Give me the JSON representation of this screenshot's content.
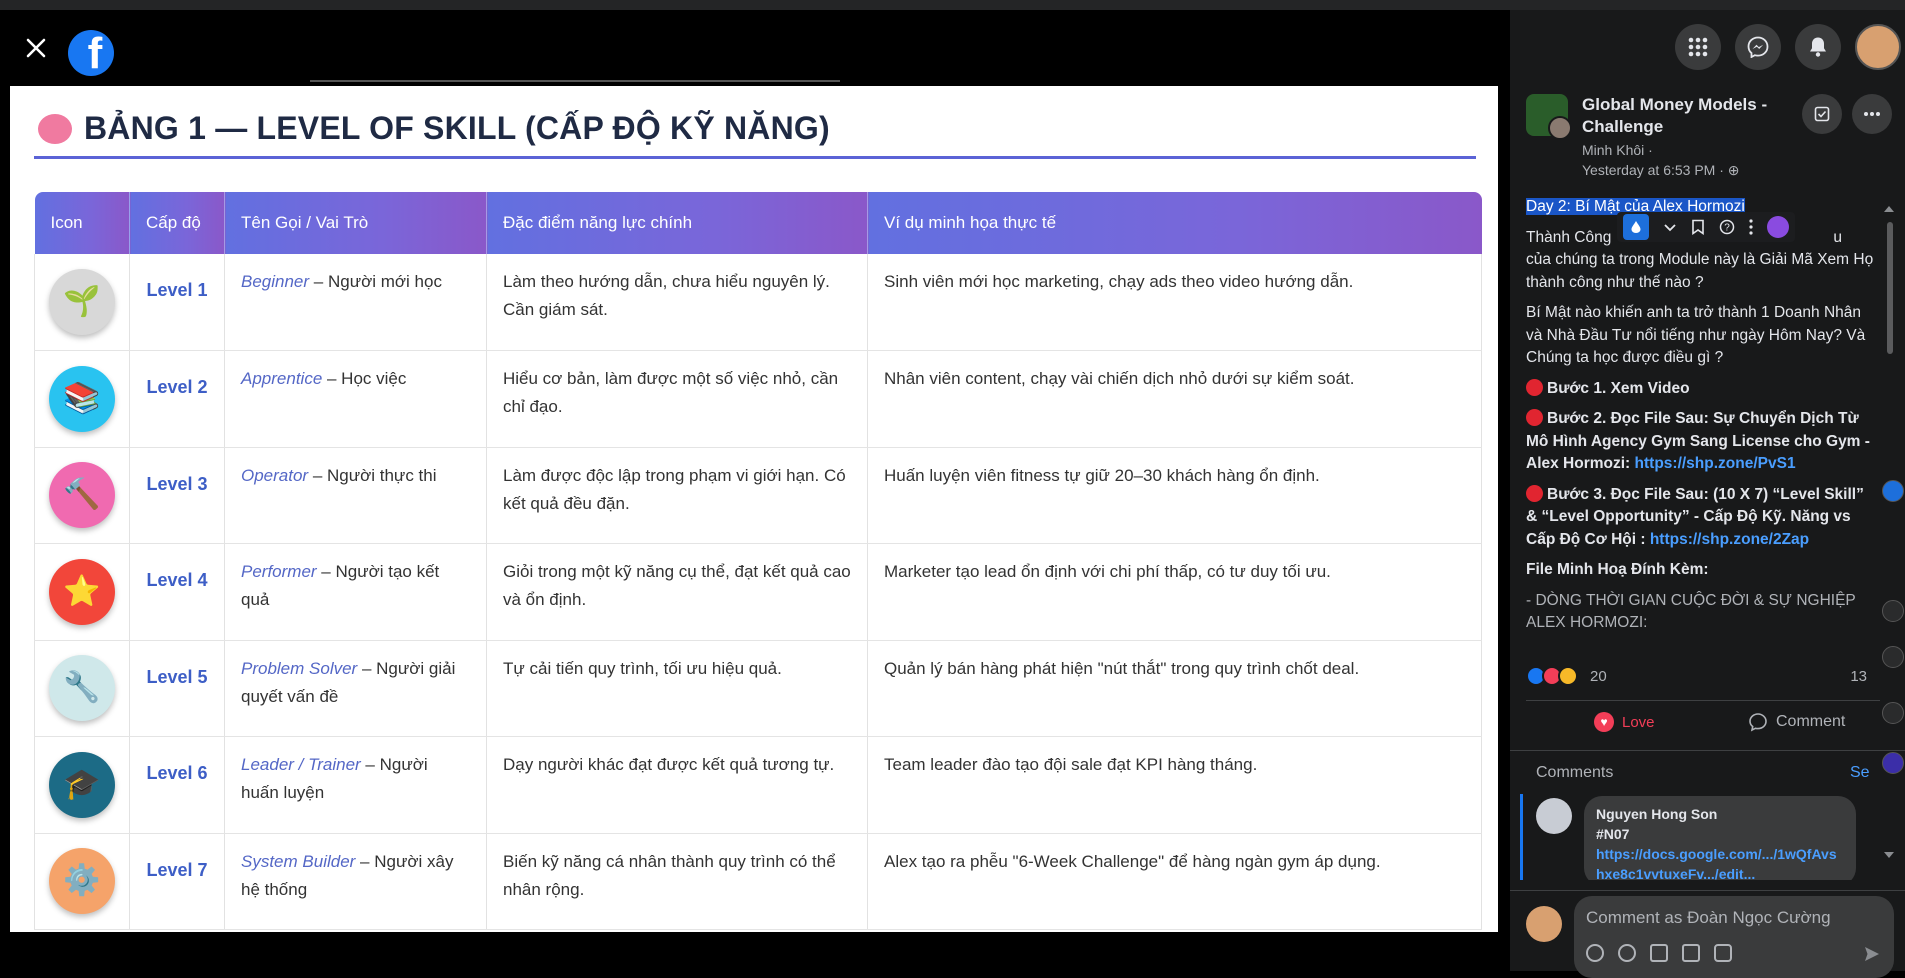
{
  "viewer": {
    "logo_letter": "f"
  },
  "image": {
    "title": "BẢNG 1 — LEVEL OF SKILL (CẤP ĐỘ KỸ NĂNG)",
    "columns": [
      "Icon",
      "Cấp độ",
      "Tên Gọi / Vai Trò",
      "Đặc điểm năng lực chính",
      "Ví dụ minh họa thực tế"
    ],
    "rows": [
      {
        "icon": "seedling-icon",
        "emoji": "🌱",
        "color": "#d8d8d8",
        "level": "Level 1",
        "role": "Beginner",
        "role_desc": " – Người mới học",
        "trait": "Làm theo hướng dẫn, chưa hiểu nguyên lý. Cần giám sát.",
        "example": "Sinh viên mới học marketing, chạy ads theo video hướng dẫn."
      },
      {
        "icon": "books-icon",
        "emoji": "📚",
        "color": "#29c3f0",
        "level": "Level 2",
        "role": "Apprentice",
        "role_desc": " – Học việc",
        "trait": "Hiểu cơ bản, làm được một số việc nhỏ, cần chỉ đạo.",
        "example": "Nhân viên content, chạy vài chiến dịch nhỏ dưới sự kiểm soát."
      },
      {
        "icon": "hammer-icon",
        "emoji": "🔨",
        "color": "#f06ab0",
        "level": "Level 3",
        "role": "Operator",
        "role_desc": " – Người thực thi",
        "trait": "Làm được độc lập trong phạm vi giới hạn. Có kết quả đều đặn.",
        "example": "Huấn luyện viên fitness tự giữ 20–30 khách hàng ổn định."
      },
      {
        "icon": "star-icon",
        "emoji": "⭐",
        "color": "#f2463a",
        "level": "Level 4",
        "role": "Performer",
        "role_desc": " – Người tạo kết quả",
        "trait": "Giỏi trong một kỹ năng cụ thể, đạt kết quả cao và ổn định.",
        "example": "Marketer tạo lead ổn định với chi phí thấp, có tư duy tối ưu."
      },
      {
        "icon": "wrench-icon",
        "emoji": "🔧",
        "color": "#cfe8ea",
        "level": "Level 5",
        "role": "Problem Solver",
        "role_desc": " – Người giải quyết vấn đề",
        "trait": "Tự cải tiến quy trình, tối ưu hiệu quả.",
        "example": "Quản lý bán hàng phát hiện \"nút thắt\" trong quy trình chốt deal."
      },
      {
        "icon": "graduation-cap-icon",
        "emoji": "🎓",
        "color": "#1c6b86",
        "level": "Level 6",
        "role": "Leader / Trainer",
        "role_desc": " – Người huấn luyện",
        "trait": "Dạy người khác đạt được kết quả tương tự.",
        "example": "Team leader đào tạo đội sale đạt KPI hàng tháng."
      },
      {
        "icon": "gear-icon",
        "emoji": "⚙️",
        "color": "#f5a36a",
        "level": "Level 7",
        "role": "System Builder",
        "role_desc": " – Người xây hệ thống",
        "trait": "Biến kỹ năng cá nhân thành quy trình có thể nhân rộng.",
        "example": "Alex tạo ra phễu \"6-Week Challenge\" để hàng ngàn gym áp dụng."
      }
    ]
  },
  "post": {
    "group_name": "Global Money Models - Challenge",
    "author": "Minh Khôi ·",
    "time": "Yesterday at 6:53 PM · ⊕",
    "title_highlight": "Day 2: Bí Mật của Alex Hormozi",
    "p1_start": "Thành Công",
    "p1_end": "u",
    "p1_rest": "của chúng ta trong Module này là Giải Mã Xem Họ thành công như thế nào ?",
    "p2": "Bí Mật nào khiến anh ta trở thành 1 Doanh Nhân và Nhà Đầu Tư nổi tiếng như ngày Hôm Nay? Và Chúng ta học được điều gì ?",
    "step1": "Bước 1. Xem Video",
    "step2": "Bước 2. Đọc File Sau: Sự Chuyển Dịch Từ Mô Hình Agency Gym Sang License cho Gym - Alex Hormozi:",
    "step2_link": "https://shp.zone/PvS1",
    "step3": "Bước 3. Đọc File Sau: (10 X 7) “Level Skill” & “Level Opportunity” - Cấp Độ Kỹ. Năng vs Cấp Độ Cơ Hội :",
    "step3_link": "https://shp.zone/2Zap",
    "attach_title": "File Minh Hoạ Đính Kèm:",
    "attach_item": "- DÒNG THỜI GIAN CUỘC ĐỜI & SỰ NGHIỆP ALEX HORMOZI:",
    "reaction_count": "20",
    "comment_count": "13",
    "love_label": "Love",
    "comment_label": "Comment"
  },
  "comments": {
    "label": "Comments",
    "see_label": "Se",
    "items": [
      {
        "name": "Nguyen Hong Son",
        "text": "#N07",
        "link": "https://docs.google.com/.../1wQfAvshxe8c1vvtuxeFv.../edit..."
      }
    ],
    "input_placeholder": "Comment as Đoàn Ngọc Cường"
  },
  "colors": {
    "accent": "#1877f2",
    "love": "#f33e58",
    "link": "#4a9eff",
    "table_header_start": "#6270e0",
    "table_header_end": "#8a58c9"
  }
}
